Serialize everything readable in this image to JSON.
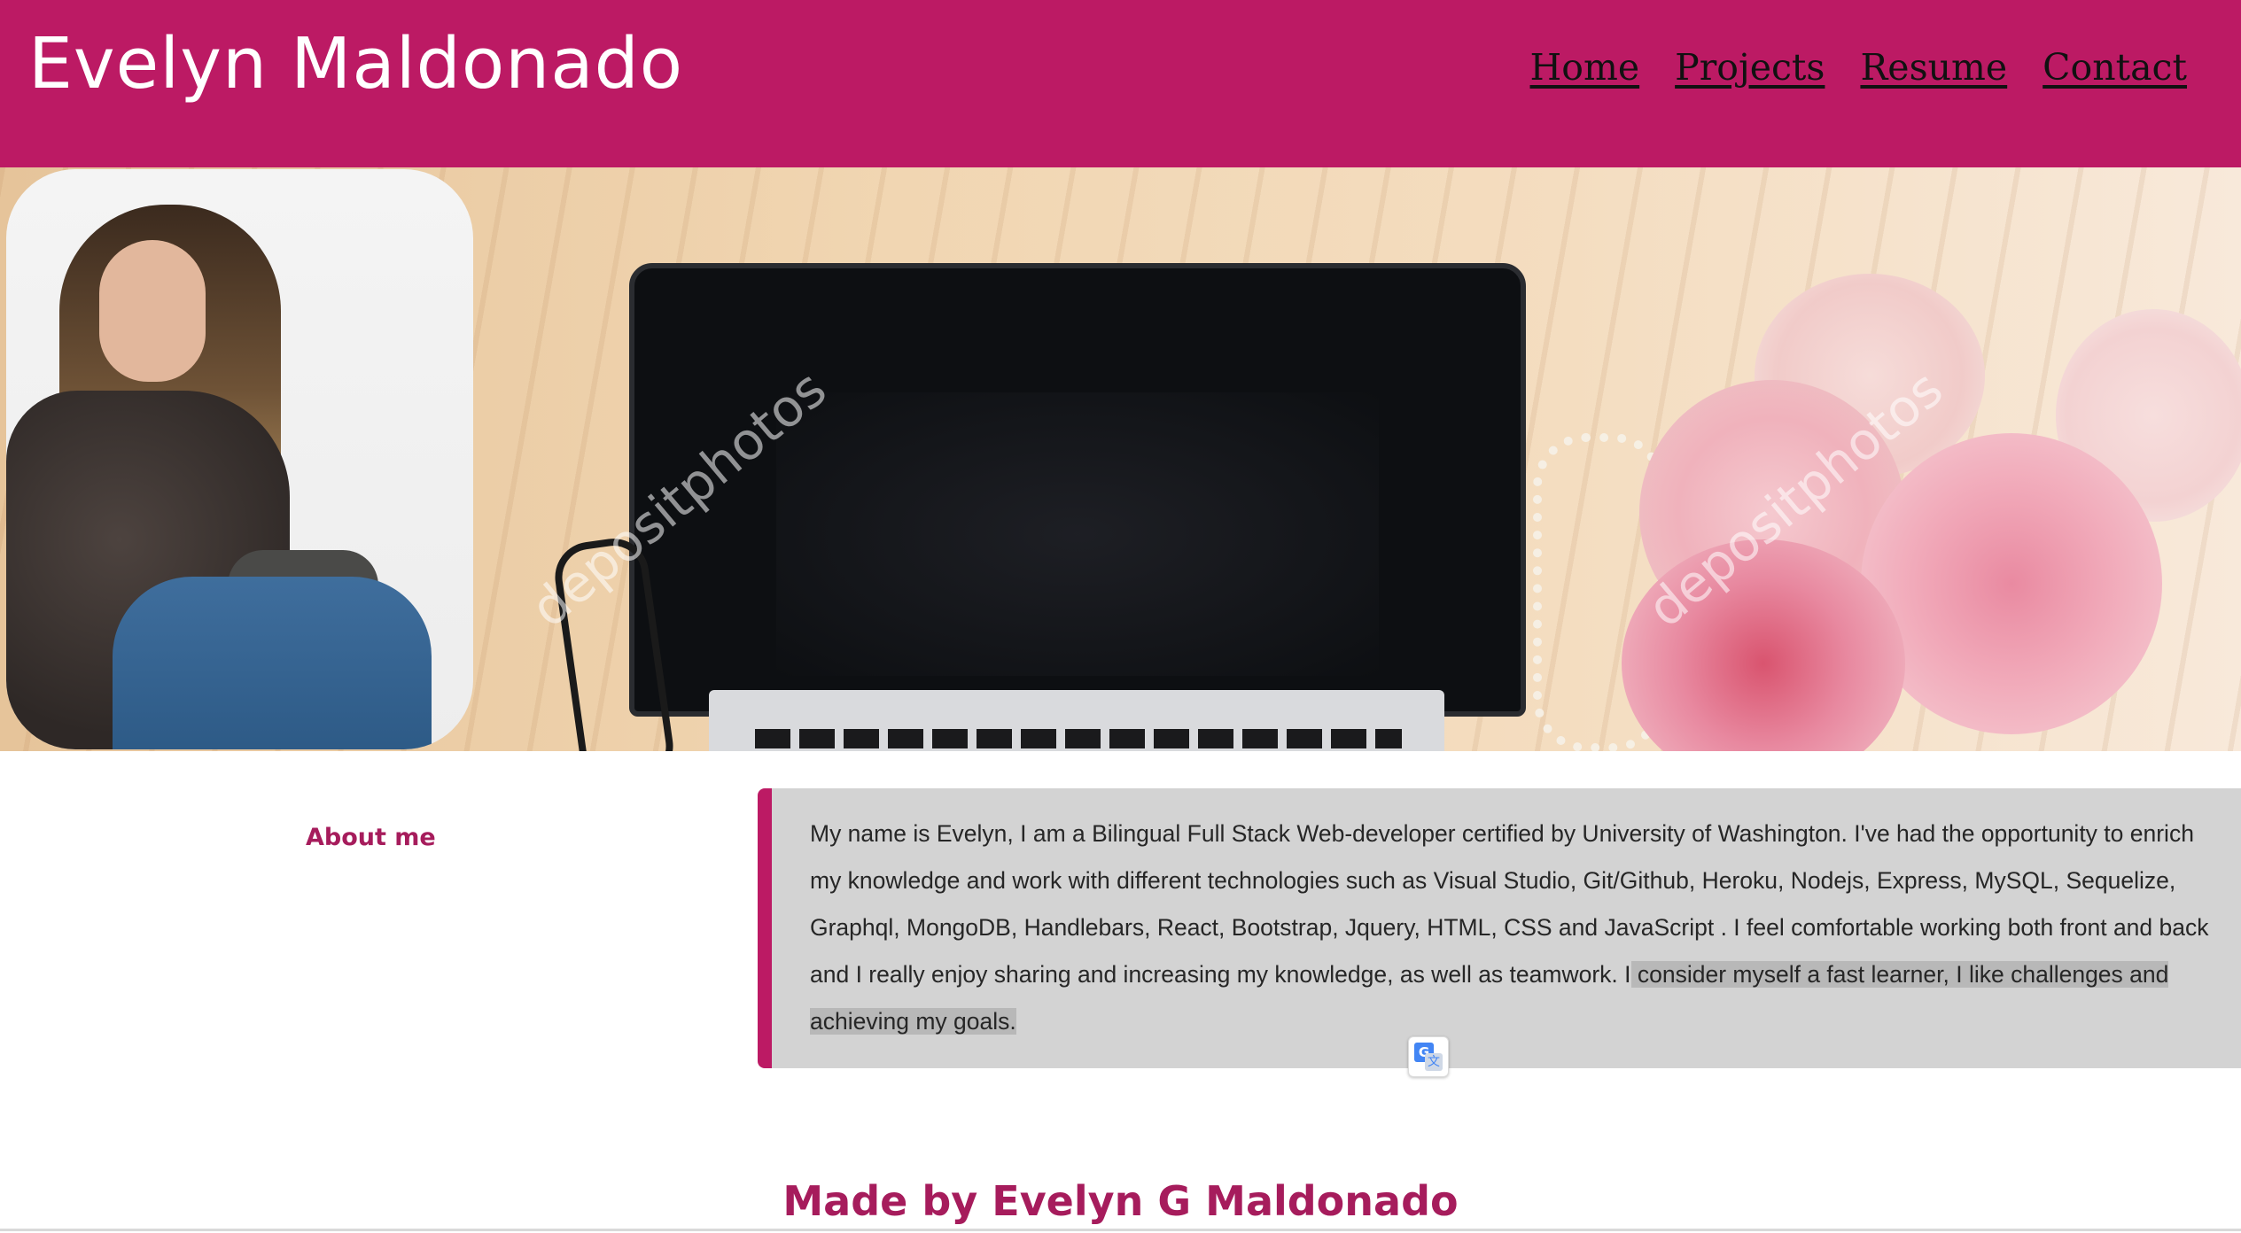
{
  "header": {
    "title": "Evelyn Maldonado",
    "background_color": "#bc1a64",
    "nav": [
      {
        "label": "Home"
      },
      {
        "label": "Projects"
      },
      {
        "label": "Resume"
      },
      {
        "label": "Contact"
      }
    ]
  },
  "hero": {
    "watermark": "depositphotos"
  },
  "about": {
    "heading": "About me",
    "text_before_selection": "My name is Evelyn, I am a Bilingual Full Stack Web-developer certified by University of Washington. I've had the opportunity to enrich my knowledge and work with different technologies such as Visual Studio, Git/Github, Heroku, Nodejs, Express, MySQL, Sequelize, Graphql, MongoDB, Handlebars, React, Bootstrap, Jquery, HTML, CSS and JavaScript . I feel comfortable working both front and back and I really enjoy sharing and increasing my knowledge, as well as teamwork. I",
    "text_selected": " consider myself a fast learner, I like challenges and achieving my goals.",
    "accent_color": "#bc1a64"
  },
  "translate_icon": "google-translate-icon",
  "footer": {
    "text": "Made by Evelyn G Maldonado"
  }
}
